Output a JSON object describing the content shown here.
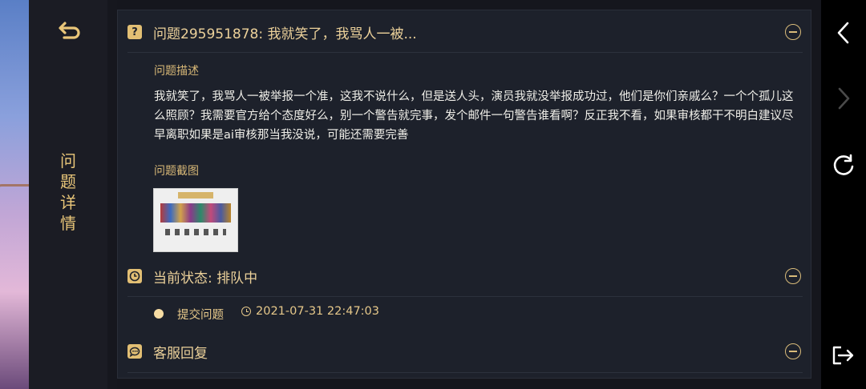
{
  "sidebar": {
    "title": "问题详情",
    "back_icon": "return-arrow-icon"
  },
  "question": {
    "header": "问题295951878: 我就笑了，我骂人一被...",
    "desc_label": "问题描述",
    "description": "我就笑了，我骂人一被举报一个准，这我不说什么，但是送人头，演员我就没举报成功过，他们是你们亲戚么？一个个孤儿这么照顾？我需要官方给个态度好么，别一个警告就完事，发个邮件一句警告谁看啊？反正我不看，如果审核都干不明白建议尽早离职如果是ai审核那当我没说，可能还需要完善",
    "screenshot_label": "问题截图"
  },
  "status": {
    "header": "当前状态: 排队中",
    "timeline_label": "提交问题",
    "timeline_time": "2021-07-31 22:47:03"
  },
  "reply": {
    "header": "客服回复"
  },
  "colors": {
    "accent": "#e2bf74",
    "panel_bg": "#1d212b",
    "text": "#f0efe9"
  },
  "browser_controls": [
    "back-icon",
    "forward-icon",
    "reload-icon",
    "exit-icon"
  ]
}
